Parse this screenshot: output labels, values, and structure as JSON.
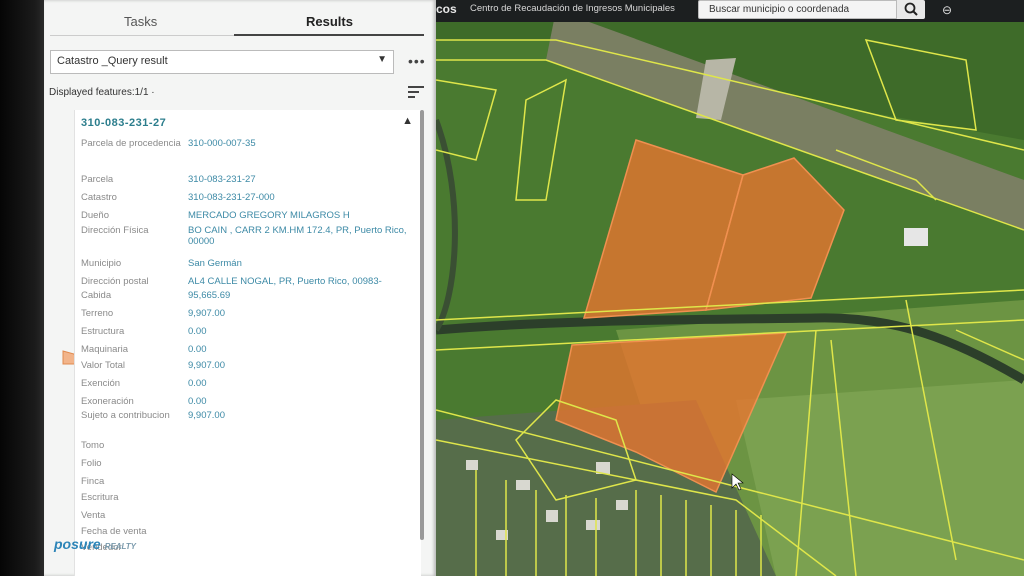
{
  "tabs": {
    "tasks": "Tasks",
    "results": "Results"
  },
  "query": {
    "selected": "Catastro _Query result",
    "more": "•••"
  },
  "displayed": "Displayed features:1/1 ·",
  "record": {
    "title": "310-083-231-27",
    "rows": [
      {
        "label": "Parcela de procedencia",
        "value": "310-000-007-35"
      },
      {
        "label": "Parcela",
        "value": "310-083-231-27"
      },
      {
        "label": "Catastro",
        "value": "310-083-231-27-000"
      },
      {
        "label": "Dueño",
        "value": "MERCADO GREGORY MILAGROS H"
      },
      {
        "label": "Dirección Física",
        "value": "BO CAIN , CARR 2 KM.HM 172.4, PR, Puerto Rico, 00000"
      },
      {
        "label": "Municipio",
        "value": "San Germán"
      },
      {
        "label": "Dirección postal",
        "value": "AL4 CALLE NOGAL, PR, Puerto Rico, 00983-"
      },
      {
        "label": "Cabida",
        "value": "95,665.69"
      },
      {
        "label": "Terreno",
        "value": "9,907.00"
      },
      {
        "label": "Estructura",
        "value": "0.00"
      },
      {
        "label": "Maquinaria",
        "value": "0.00"
      },
      {
        "label": "Valor Total",
        "value": "9,907.00"
      },
      {
        "label": "Exención",
        "value": "0.00"
      },
      {
        "label": "Exoneración",
        "value": "0.00"
      },
      {
        "label": "Sujeto a contribucion",
        "value": "9,907.00"
      },
      {
        "label": "Tomo",
        "value": ""
      },
      {
        "label": "Folio",
        "value": ""
      },
      {
        "label": "Finca",
        "value": ""
      },
      {
        "label": "Escritura",
        "value": ""
      },
      {
        "label": "Venta",
        "value": ""
      },
      {
        "label": "Fecha de venta",
        "value": ""
      },
      {
        "label": "Vendedor",
        "value": ""
      }
    ]
  },
  "topbar": {
    "app_fragment": "cos",
    "agency": "Centro de Recaudación de Ingresos Municipales",
    "search_placeholder": "Buscar municipio o coordenada"
  },
  "logo": {
    "text": "posure",
    "sub": "REALTY"
  },
  "colors": {
    "parcel_fill": "#e9742f",
    "parcel_line": "#d9e34a",
    "link": "#3d8aa6"
  }
}
